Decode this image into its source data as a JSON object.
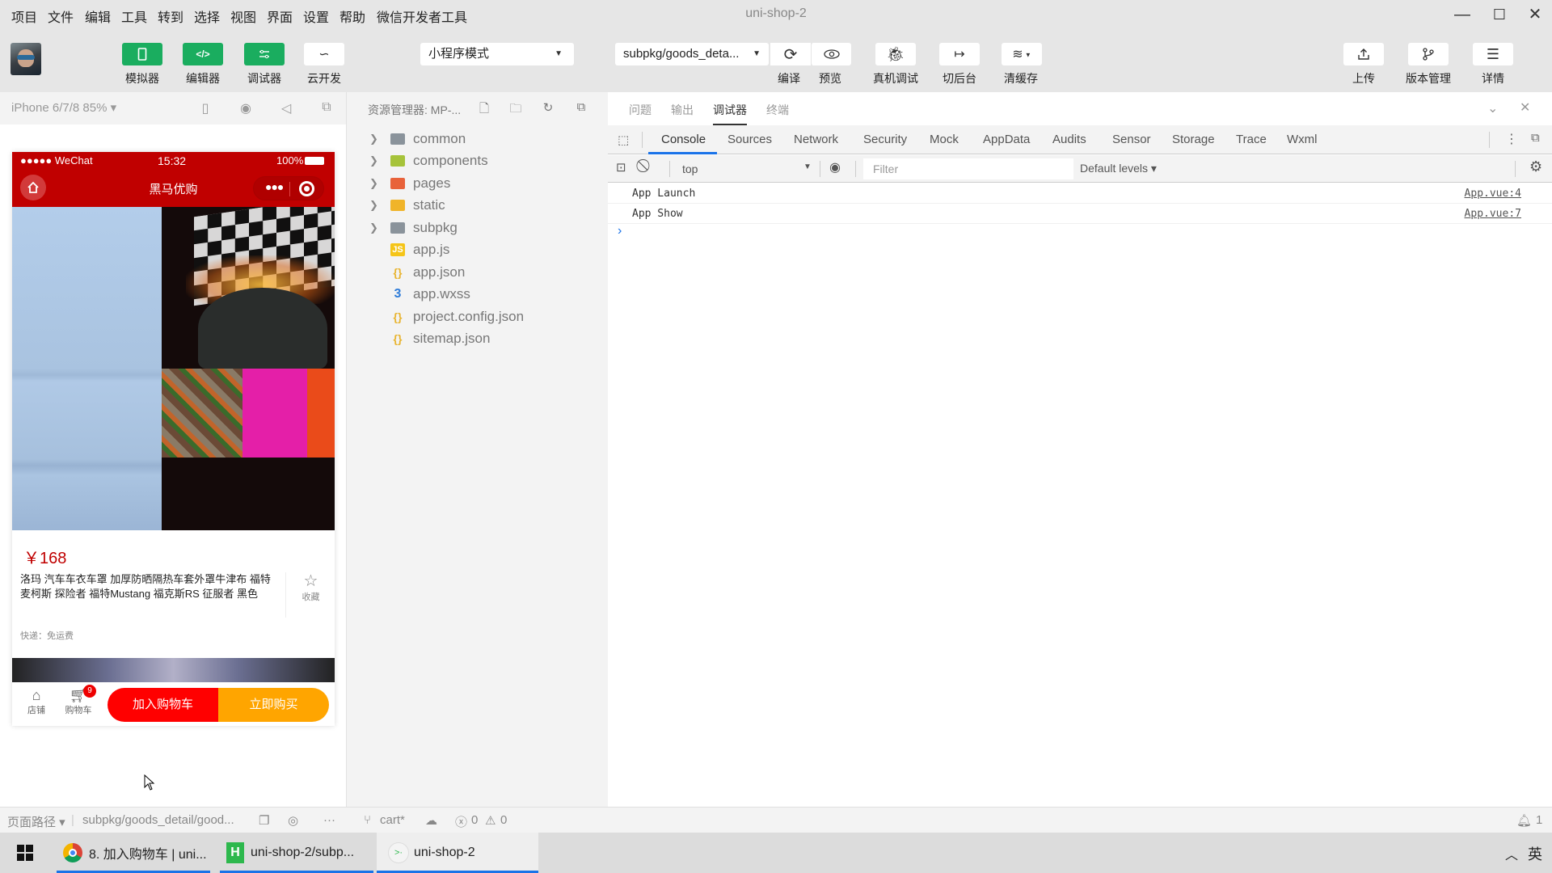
{
  "window": {
    "title": "uni-shop-2",
    "menu": [
      "项目",
      "文件",
      "编辑",
      "工具",
      "转到",
      "选择",
      "视图",
      "界面",
      "设置",
      "帮助",
      "微信开发者工具"
    ],
    "controls": {
      "minimize": "—",
      "maximize": "☐",
      "close": "✕"
    }
  },
  "toolbar": {
    "left_buttons": [
      {
        "label": "模拟器",
        "icon": "phone-icon"
      },
      {
        "label": "编辑器",
        "icon": "code-icon"
      },
      {
        "label": "调试器",
        "icon": "debug-sliders-icon"
      },
      {
        "label": "云开发",
        "icon": "cloud-icon"
      }
    ],
    "mode_select": "小程序模式",
    "page_select": "subpkg/goods_deta...",
    "compile_label": "编译",
    "preview_label": "预览",
    "remote_debug_label": "真机调试",
    "background_label": "切后台",
    "clear_cache_label": "清缓存",
    "upload_label": "上传",
    "version_label": "版本管理",
    "details_label": "详情"
  },
  "simulator": {
    "device": "iPhone 6/7/8 85% ▾",
    "statusbar": {
      "carrier": "●●●●● WeChat",
      "time": "15:32",
      "battery": "100%"
    },
    "nav_title": "黑马优购",
    "price": "￥168",
    "goods_title": "洛玛 汽车车衣车罩 加厚防晒隔热车套外罩牛津布 福特麦柯斯 探险者 福特Mustang 福克斯RS 征服者 黑色",
    "fav_label": "收藏",
    "shipping": "快递：免运费",
    "shop_label": "店铺",
    "cart_label": "购物车",
    "cart_badge": "9",
    "add_cart": "加入购物车",
    "buy_now": "立即购买",
    "colors": {
      "brand": "#c00000",
      "add_cart": "#ff0000",
      "buy_now": "#ffa500"
    }
  },
  "explorer": {
    "header": "资源管理器: MP-...",
    "items": [
      {
        "name": "common",
        "type": "folder",
        "color": "#8a939b"
      },
      {
        "name": "components",
        "type": "folder",
        "color": "#a6c33a"
      },
      {
        "name": "pages",
        "type": "folder",
        "color": "#e8623a"
      },
      {
        "name": "static",
        "type": "folder",
        "color": "#f0b429"
      },
      {
        "name": "subpkg",
        "type": "folder",
        "color": "#8a939b"
      },
      {
        "name": "app.js",
        "type": "js",
        "color": "#f5c518"
      },
      {
        "name": "app.json",
        "type": "json",
        "color": "#e8b430"
      },
      {
        "name": "app.wxss",
        "type": "css",
        "color": "#2d7bd8"
      },
      {
        "name": "project.config.json",
        "type": "json",
        "color": "#e8b430"
      },
      {
        "name": "sitemap.json",
        "type": "json",
        "color": "#e8b430"
      }
    ]
  },
  "devtools": {
    "top_tabs": [
      "问题",
      "输出",
      "调试器",
      "终端"
    ],
    "active_top_tab": "调试器",
    "tabs": [
      "Console",
      "Sources",
      "Network",
      "Security",
      "Mock",
      "AppData",
      "Audits",
      "Sensor",
      "Storage",
      "Trace",
      "Wxml"
    ],
    "active_tab": "Console",
    "context": "top",
    "filter_placeholder": "Filter",
    "levels": "Default levels ▾",
    "logs": [
      {
        "msg": "App  Launch",
        "src": "App.vue:4"
      },
      {
        "msg": "App  Show",
        "src": "App.vue:7"
      }
    ],
    "prompt": "›"
  },
  "statusbar": {
    "page_path_label": "页面路径 ▾",
    "page_path": "subpkg/goods_detail/good...",
    "branch": "cart*",
    "errors": "0",
    "warnings": "0",
    "notifications": "1"
  },
  "taskbar": {
    "items": [
      {
        "label": "8. 加入购物车 | uni...",
        "app": "chrome"
      },
      {
        "label": "uni-shop-2/subp...",
        "app": "hbuilderx"
      },
      {
        "label": "uni-shop-2",
        "app": "wechat-devtools"
      }
    ],
    "ime": "英"
  }
}
